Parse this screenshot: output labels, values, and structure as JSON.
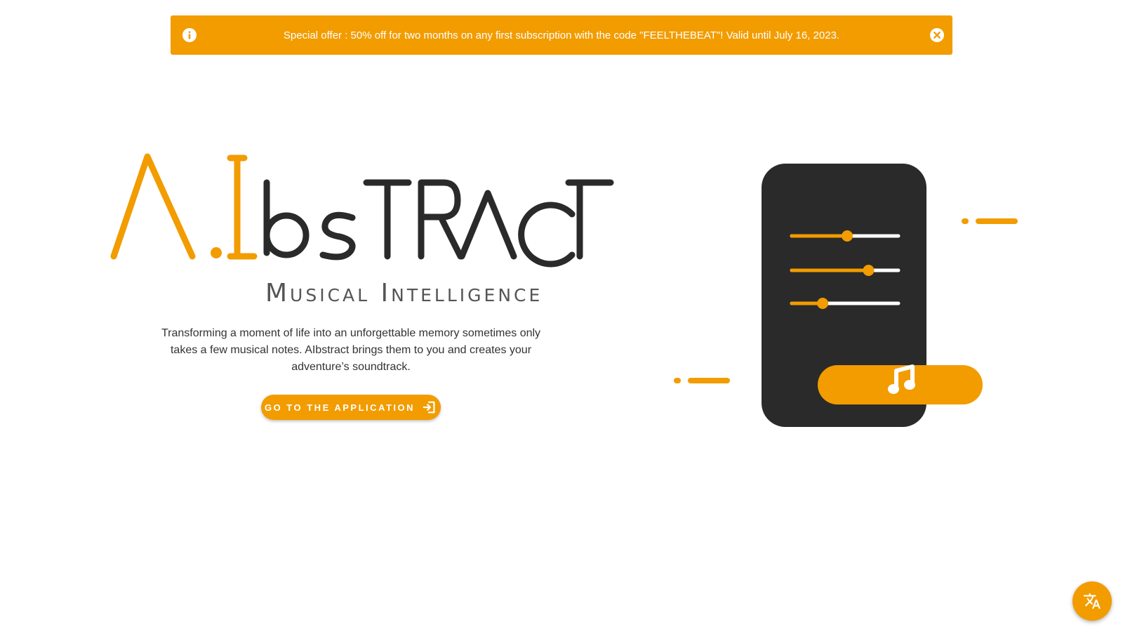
{
  "banner": {
    "message": "Special offer : 50% off for two months on any first subscription with the code \"FEELTHEBEAT\"! Valid until July 16, 2023.",
    "info_icon": "info-icon",
    "close_icon": "close-icon"
  },
  "logo": {
    "wordmark": "AIbstract",
    "subtitle": "Musical Intelligence"
  },
  "hero": {
    "tagline": "Transforming a moment of life into an unforgettable memory sometimes only takes a few musical notes. AIbstract brings them to you and creates your adventure’s soundtrack.",
    "cta_label": "Go to the application",
    "cta_icon": "login-icon"
  },
  "illustration": {
    "slider_levels": [
      0.52,
      0.72,
      0.29
    ],
    "button_icon": "music-note-icon"
  },
  "language_button": {
    "icon": "translate-icon"
  },
  "colors": {
    "accent": "#f29c00",
    "dark": "#2a2a2a",
    "white": "#ffffff"
  }
}
